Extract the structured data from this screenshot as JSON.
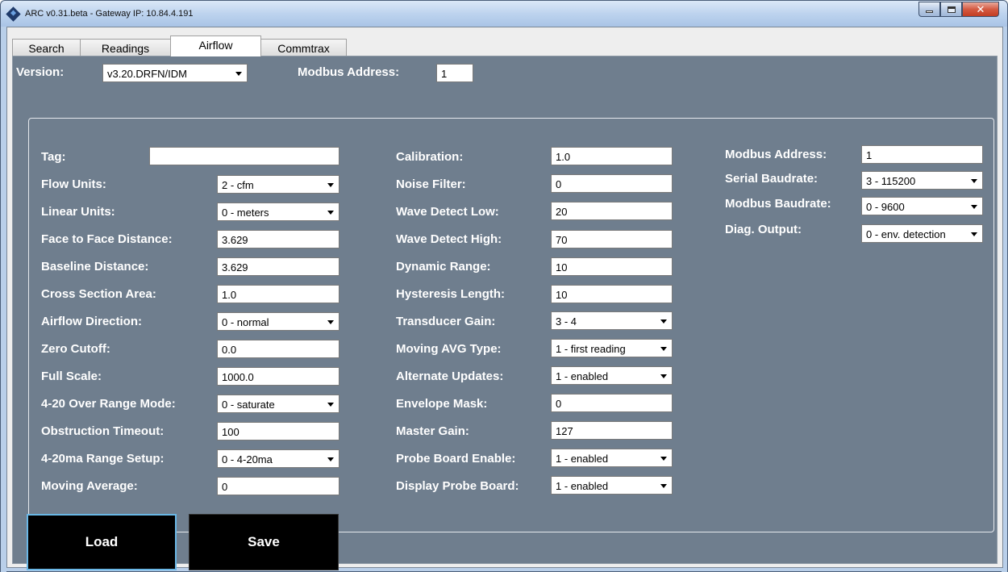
{
  "window": {
    "title": "ARC v0.31.beta - Gateway IP: 10.84.4.191"
  },
  "tabs": [
    {
      "label": "Search"
    },
    {
      "label": "Readings"
    },
    {
      "label": "Airflow",
      "active": true
    },
    {
      "label": "Commtrax"
    }
  ],
  "header": {
    "version_label": "Version:",
    "version_value": "v3.20.DRFN/IDM",
    "modbus_label": "Modbus Address:",
    "modbus_value": "1"
  },
  "col1": {
    "tag_label": "Tag:",
    "tag_value": "",
    "flow_units_label": "Flow Units:",
    "flow_units_value": "2 - cfm",
    "linear_units_label": "Linear Units:",
    "linear_units_value": "0 - meters",
    "face_label": "Face to Face Distance:",
    "face_value": "3.629",
    "baseline_label": "Baseline Distance:",
    "baseline_value": "3.629",
    "cross_label": "Cross Section Area:",
    "cross_value": "1.0",
    "direction_label": "Airflow Direction:",
    "direction_value": "0 - normal",
    "zero_label": "Zero Cutoff:",
    "zero_value": "0.0",
    "full_label": "Full Scale:",
    "full_value": "1000.0",
    "overrange_label": "4-20 Over Range Mode:",
    "overrange_value": "0 - saturate",
    "obstruction_label": "Obstruction Timeout:",
    "obstruction_value": "100",
    "range_label": "4-20ma Range Setup:",
    "range_value": "0 - 4-20ma",
    "moving_label": "Moving Average:",
    "moving_value": "0"
  },
  "col2": {
    "calibration_label": "Calibration:",
    "calibration_value": "1.0",
    "noise_label": "Noise Filter:",
    "noise_value": "0",
    "wave_low_label": "Wave Detect Low:",
    "wave_low_value": "20",
    "wave_high_label": "Wave Detect High:",
    "wave_high_value": "70",
    "dynamic_label": "Dynamic Range:",
    "dynamic_value": "10",
    "hysteresis_label": "Hysteresis Length:",
    "hysteresis_value": "10",
    "gain_label": "Transducer Gain:",
    "gain_value": "3 - 4",
    "avg_type_label": "Moving AVG Type:",
    "avg_type_value": "1 - first reading",
    "alt_label": "Alternate Updates:",
    "alt_value": "1 - enabled",
    "envelope_label": "Envelope Mask:",
    "envelope_value": "0",
    "master_label": "Master Gain:",
    "master_value": "127",
    "probe_enable_label": "Probe Board Enable:",
    "probe_enable_value": "1 - enabled",
    "probe_display_label": "Display Probe Board:",
    "probe_display_value": "1 - enabled"
  },
  "col3": {
    "modbus_label": "Modbus Address:",
    "modbus_value": "1",
    "serial_label": "Serial Baudrate:",
    "serial_value": "3 - 115200",
    "modbus_baud_label": "Modbus Baudrate:",
    "modbus_baud_value": "0 - 9600",
    "diag_label": "Diag. Output:",
    "diag_value": "0 - env. detection"
  },
  "buttons": {
    "load": "Load",
    "save": "Save"
  }
}
